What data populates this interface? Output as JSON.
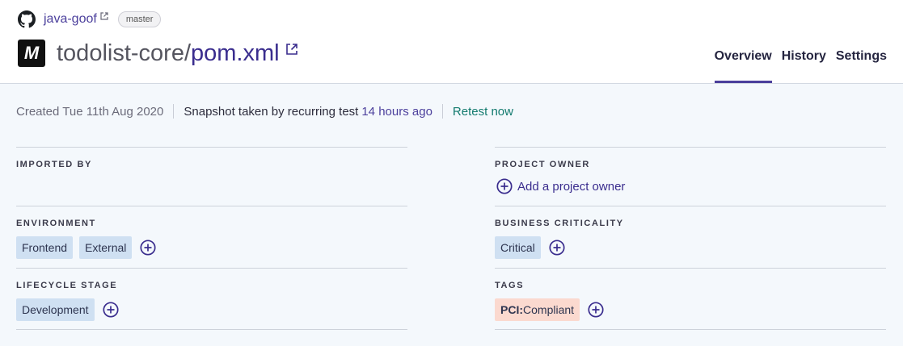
{
  "header": {
    "org_name": "java-goof",
    "branch": "master",
    "project_name": "todolist-core/",
    "file_name": "pom.xml",
    "maven_letter": "M"
  },
  "tabs": [
    {
      "label": "Overview",
      "active": true
    },
    {
      "label": "History",
      "active": false
    },
    {
      "label": "Settings",
      "active": false
    }
  ],
  "meta": {
    "created": "Created Tue 11th Aug 2020",
    "snapshot": "Snapshot taken by recurring test",
    "snapshot_time": "14 hours ago",
    "retest": "Retest now"
  },
  "attributes": {
    "imported_by": {
      "label": "IMPORTED BY"
    },
    "environment": {
      "label": "ENVIRONMENT",
      "values": [
        "Frontend",
        "External"
      ]
    },
    "lifecycle": {
      "label": "LIFECYCLE STAGE",
      "values": [
        "Development"
      ]
    },
    "project_owner": {
      "label": "PROJECT OWNER",
      "action": "Add a project owner"
    },
    "business_criticality": {
      "label": "BUSINESS CRITICALITY",
      "values": [
        "Critical"
      ]
    },
    "tags": {
      "label": "TAGS",
      "values": [
        {
          "key": "PCI",
          "sep": ":",
          "value": "Compliant"
        }
      ]
    }
  },
  "colors": {
    "accent": "#4b3f9c",
    "chip_blue": "#cfe0f2",
    "chip_tag": "#fbd9cf",
    "retest": "#127a6e",
    "background": "#f4f8fc"
  },
  "icons": [
    "github-icon",
    "external-link-icon",
    "maven-icon",
    "add-circle-icon"
  ]
}
